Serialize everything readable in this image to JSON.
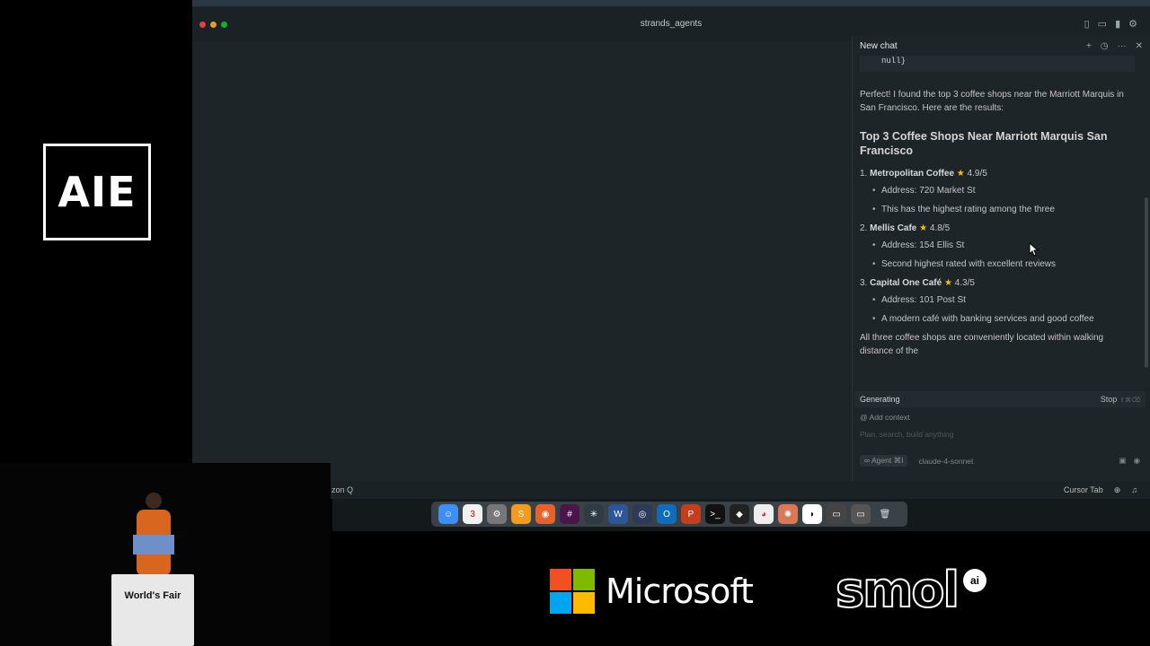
{
  "branding": {
    "aie_logo": "AIE",
    "podium_label": "World's Fair"
  },
  "sponsors": {
    "microsoft": "Microsoft",
    "smol": "smol",
    "smol_badge": "ai",
    "ms_colors": [
      "#f25022",
      "#7fba00",
      "#00a4ef",
      "#ffb900"
    ]
  },
  "window": {
    "title": "strands_agents"
  },
  "chat": {
    "header_title": "New chat",
    "code_tail": "null}",
    "intro": "Perfect! I found the top 3 coffee shops near the Marriott Marquis in San Francisco. Here are the results:",
    "heading": "Top 3 Coffee Shops Near Marriott Marquis San Francisco",
    "shops": [
      {
        "num": "1.",
        "name": "Metropolitan Coffee",
        "rating": "4.9/5",
        "bullets": [
          "Address: 720 Market St",
          "This has the highest rating among the three"
        ]
      },
      {
        "num": "2.",
        "name": "Mellis Cafe",
        "rating": "4.8/5",
        "bullets": [
          "Address: 154 Ellis St",
          "Second highest rated with excellent reviews"
        ]
      },
      {
        "num": "3.",
        "name": "Capital One Café",
        "rating": "4.3/5",
        "bullets": [
          "Address: 101 Post St",
          "A modern café with banking services and good coffee"
        ]
      }
    ],
    "closing": "All three coffee shops are conveniently located within walking distance of the",
    "generating_label": "Generating",
    "stop_label": "Stop",
    "add_context": "Add context",
    "input_placeholder": "Plan, search, build anything",
    "agent_label": "Agent",
    "model_label": "claude-4-sonnet"
  },
  "statusbar": {
    "left_text": "zon Q",
    "cursor_tab": "Cursor Tab"
  }
}
